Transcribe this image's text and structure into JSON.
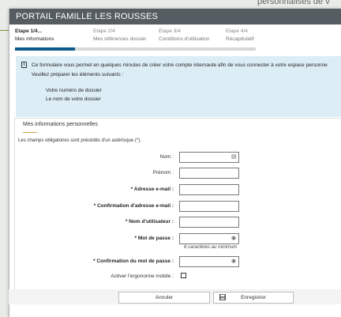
{
  "background": {
    "text": "personnalisés de v"
  },
  "header": {
    "title": "PORTAIL FAMILLE LES ROUSSES"
  },
  "steps": [
    {
      "num": "Etape 1/4...",
      "name": "Mes informations",
      "active": true
    },
    {
      "num": "Etape 2/4",
      "name": "Mes références dossier",
      "active": false
    },
    {
      "num": "Etape 3/4",
      "name": "Conditions d'utilisation",
      "active": false
    },
    {
      "num": "Etape 4/4",
      "name": "Récapitulatif",
      "active": false
    }
  ],
  "progress": {
    "fraction": 0.25,
    "color": "#0c5a8c"
  },
  "info": {
    "line1": "Ce formulaire vous permet en quelques minutes de créer votre compte internaute afin de vous connecter à votre espace personne",
    "line2": "Veuillez préparer les éléments suivants :",
    "item1": "Votre numéro de dossier",
    "item2": "Le nom de votre dossier"
  },
  "form": {
    "section_title": "Mes informations personnelles",
    "note": "Les champs obligatoires sont précédés d'un astérisque (*).",
    "nom_label": "Nom :",
    "prenom_label": "Prénom :",
    "email_label": "* Adresse e-mail :",
    "email_confirm_label": "* Confirmation d'adresse e-mail :",
    "username_label": "* Nom d'utilisateur :",
    "password_label": "* Mot de passe :",
    "password_hint": "6 caractères au minimum",
    "password_confirm_label": "* Confirmation du mot de passe :",
    "mobile_label": "Activer l'ergonomie mobile :"
  },
  "footer": {
    "cancel_label": "Annuler",
    "save_label": "Enregistrer"
  },
  "colors": {
    "header_bg": "#555d62",
    "info_bg": "#dcedf6",
    "accent": "#c9a24a"
  }
}
